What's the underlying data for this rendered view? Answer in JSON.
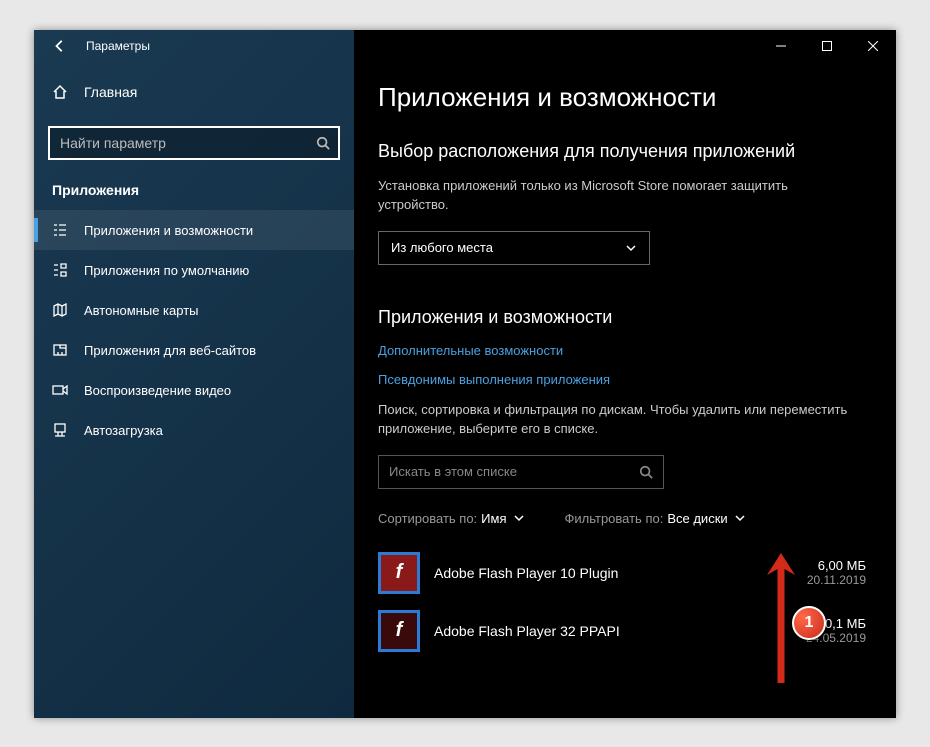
{
  "titlebar": {
    "title": "Параметры"
  },
  "sidebar": {
    "home": "Главная",
    "search_placeholder": "Найти параметр",
    "section": "Приложения",
    "items": [
      {
        "label": "Приложения и возможности",
        "active": true
      },
      {
        "label": "Приложения по умолчанию"
      },
      {
        "label": "Автономные карты"
      },
      {
        "label": "Приложения для веб-сайтов"
      },
      {
        "label": "Воспроизведение видео"
      },
      {
        "label": "Автозагрузка"
      }
    ]
  },
  "content": {
    "page_title": "Приложения и возможности",
    "source_heading": "Выбор расположения для получения приложений",
    "source_desc": "Установка приложений только из Microsoft Store помогает защитить устройство.",
    "source_dropdown": "Из любого места",
    "apps_heading": "Приложения и возможности",
    "link_optional": "Дополнительные возможности",
    "link_aliases": "Псевдонимы выполнения приложения",
    "filter_desc": "Поиск, сортировка и фильтрация по дискам. Чтобы удалить или переместить приложение, выберите его в списке.",
    "list_search_placeholder": "Искать в этом списке",
    "sort_label": "Сортировать по:",
    "sort_value": "Имя",
    "filter_label": "Фильтровать по:",
    "filter_value": "Все диски",
    "apps": [
      {
        "name": "Adobe Flash Player 10 Plugin",
        "size": "6,00 МБ",
        "date": "20.11.2019",
        "icon_glyph": "f"
      },
      {
        "name": "Adobe Flash Player 32 PPAPI",
        "size": "20,1 МБ",
        "date": "24.05.2019",
        "icon_glyph": "f"
      }
    ]
  },
  "annotation": {
    "badge": "1"
  }
}
